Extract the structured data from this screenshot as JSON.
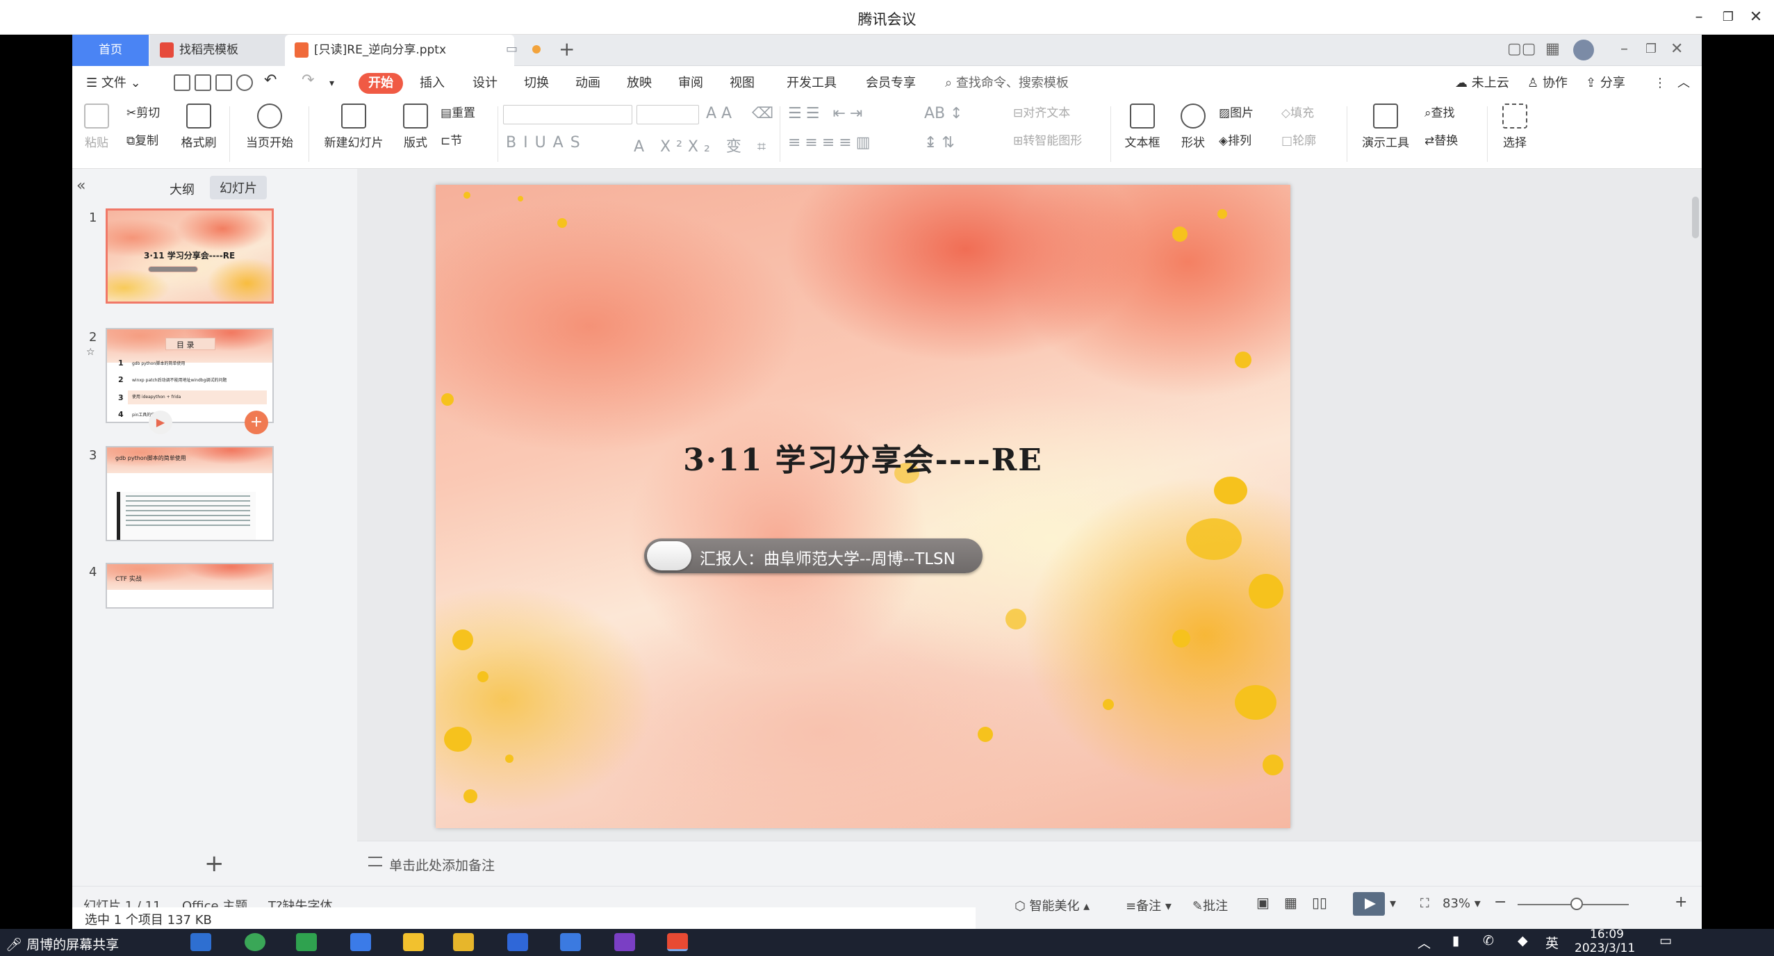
{
  "meeting": {
    "title": "腾讯会议"
  },
  "tabs": {
    "home": "首页",
    "template": "找稻壳模板",
    "document": "[只读]RE_逆向分享.pptx"
  },
  "menu": {
    "file": "文件",
    "items": [
      "开始",
      "插入",
      "设计",
      "切换",
      "动画",
      "放映",
      "审阅",
      "视图",
      "开发工具",
      "会员专享"
    ],
    "search_placeholder": "查找命令、搜索模板",
    "cloud": "未上云",
    "collab": "协作",
    "share": "分享"
  },
  "ribbon": {
    "paste": "粘贴",
    "cut": "剪切",
    "copy": "复制",
    "format_painter": "格式刷",
    "from_current": "当页开始",
    "new_slide": "新建幻灯片",
    "layout": "版式",
    "section": "节",
    "reset": "重置",
    "align_text": "对齐文本",
    "smart_graphic": "转智能图形",
    "textbox": "文本框",
    "shape": "形状",
    "picture": "图片",
    "arrange": "排列",
    "fill": "填充",
    "outline": "轮廓",
    "present_tools": "演示工具",
    "find": "查找",
    "replace": "替换",
    "select": "选择"
  },
  "left_pane": {
    "outline_tab": "大纲",
    "slides_tab": "幻灯片",
    "thumbs": [
      {
        "num": "1",
        "title": "3·11 学习分享会----RE"
      },
      {
        "num": "2",
        "title": "目  录",
        "items": [
          {
            "n": "1",
            "text": "gdb python脚本的简单使用"
          },
          {
            "n": "2",
            "text": "winxp patch后动调不能用地址windbg调试的问题"
          },
          {
            "n": "3",
            "text": "使用 ideapython + frida"
          },
          {
            "n": "4",
            "text": "pin工具的使用"
          }
        ]
      },
      {
        "num": "3",
        "title": "gdb python脚本的简单使用"
      },
      {
        "num": "4",
        "title": "CTF 实战"
      }
    ]
  },
  "slide": {
    "title": "3·11 学习分享会----RE",
    "presenter": "汇报人：曲阜师范大学--周博--TLSN"
  },
  "notes": {
    "placeholder": "单击此处添加备注"
  },
  "status": {
    "slide_count": "幻灯片 1 / 11",
    "theme": "Office 主题",
    "missing_font": "缺失字体",
    "beautify": "智能美化",
    "notes_btn": "备注",
    "comment_btn": "批注",
    "zoom": "83%"
  },
  "explorer": {
    "selection": "选中 1 个项目  137 KB"
  },
  "taskbar": {
    "share_label": "周博的屏幕共享",
    "ime": "英",
    "time": "16:09",
    "date": "2023/3/11"
  },
  "colors": {
    "accent": "#4a84f4",
    "start_tab": "#f05a44",
    "slide_frame": "#f07868"
  }
}
